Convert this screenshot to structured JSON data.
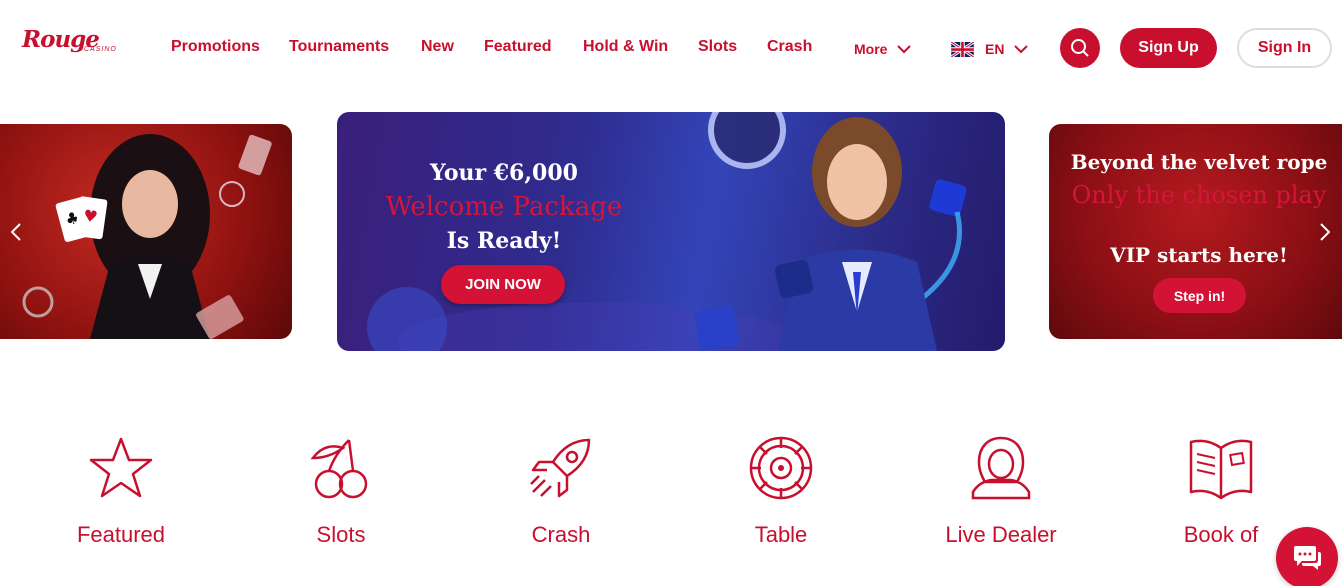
{
  "brand": {
    "name": "Rouge",
    "subname": "CASINO"
  },
  "nav": {
    "items": [
      {
        "label": "Promotions"
      },
      {
        "label": "Tournaments"
      },
      {
        "label": "New"
      },
      {
        "label": "Featured"
      },
      {
        "label": "Hold & Win"
      },
      {
        "label": "Slots"
      },
      {
        "label": "Crash"
      }
    ],
    "more_label": "More",
    "language": "EN",
    "signup_label": "Sign Up",
    "signin_label": "Sign In"
  },
  "carousel": {
    "center": {
      "line1": "Your €6,000",
      "line2": "Welcome Package",
      "line3": "Is Ready!",
      "button": "JOIN NOW"
    },
    "right": {
      "line1": "Beyond the velvet rope",
      "line2": "Only the chosen play",
      "line3": "VIP starts here!",
      "button": "Step in!"
    }
  },
  "categories": [
    {
      "label": "Featured",
      "icon": "star-icon"
    },
    {
      "label": "Slots",
      "icon": "cherries-icon"
    },
    {
      "label": "Crash",
      "icon": "rocket-icon"
    },
    {
      "label": "Table",
      "icon": "roulette-icon"
    },
    {
      "label": "Live Dealer",
      "icon": "dealer-icon"
    },
    {
      "label": "Book of",
      "icon": "book-icon"
    }
  ],
  "colors": {
    "accent": "#c8102e",
    "button": "#d31236"
  }
}
